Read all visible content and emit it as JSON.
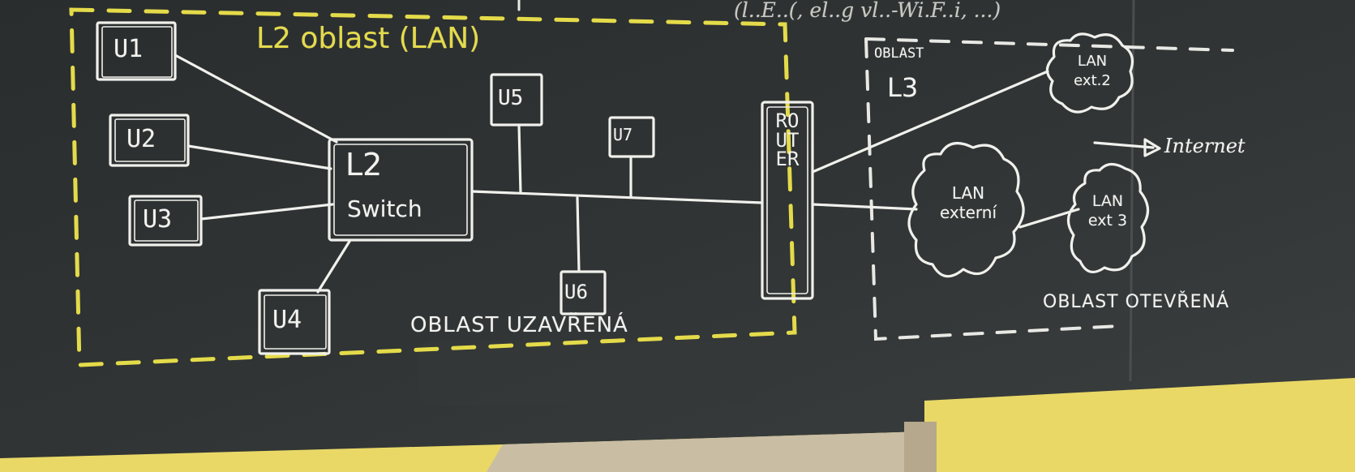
{
  "top_scrawl": "(l..E..(, el..g vl..-Wi.F..i, ...)",
  "l2_region": {
    "title": "L2 oblast (LAN)",
    "caption": "OBLAST UZAVŘENÁ"
  },
  "l3_region": {
    "title_line1": "OBLAST",
    "title_line2": "L3",
    "caption": "OBLAST OTEVŘENÁ"
  },
  "switch": {
    "line1": "L2",
    "line2": "Switch"
  },
  "router": {
    "label": "ROUTER"
  },
  "users": [
    "U1",
    "U2",
    "U3",
    "U4",
    "U5",
    "U6",
    "U7"
  ],
  "clouds": {
    "ext2": "LAN ext.2",
    "externi": "LAN externí",
    "ext3": "LAN ext 3"
  },
  "internet_label": "Internet",
  "colors": {
    "chalkboard": "#2e3131",
    "chalk_white": "#f2f2ef",
    "chalk_yellow": "#e4db4a",
    "wall": "#e9d866"
  }
}
